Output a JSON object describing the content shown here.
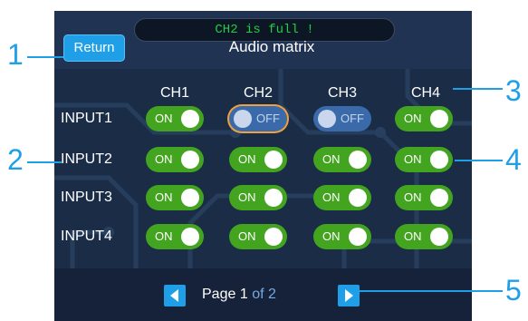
{
  "header": {
    "notice": "CH2 is full !",
    "title": "Audio matrix",
    "return_label": "Return"
  },
  "matrix": {
    "columns": [
      "CH1",
      "CH2",
      "CH3",
      "CH4"
    ],
    "rows": [
      {
        "label": "INPUT1",
        "states": [
          "ON",
          "OFF",
          "OFF",
          "ON"
        ]
      },
      {
        "label": "INPUT2",
        "states": [
          "ON",
          "ON",
          "ON",
          "ON"
        ]
      },
      {
        "label": "INPUT3",
        "states": [
          "ON",
          "ON",
          "ON",
          "ON"
        ]
      },
      {
        "label": "INPUT4",
        "states": [
          "ON",
          "ON",
          "ON",
          "ON"
        ]
      }
    ],
    "selected": {
      "row": 0,
      "col": 1
    }
  },
  "pagination": {
    "page_word": "Page",
    "current": "1",
    "of_text": "of 2"
  },
  "annotations": {
    "n1": "1",
    "n2": "2",
    "n3": "3",
    "n4": "4",
    "n5": "5"
  },
  "colors": {
    "accent": "#1e9fe8",
    "on": "#43a420",
    "off": "#3a6aa9",
    "notice_text": "#22cc44",
    "selection": "#f0a040"
  }
}
